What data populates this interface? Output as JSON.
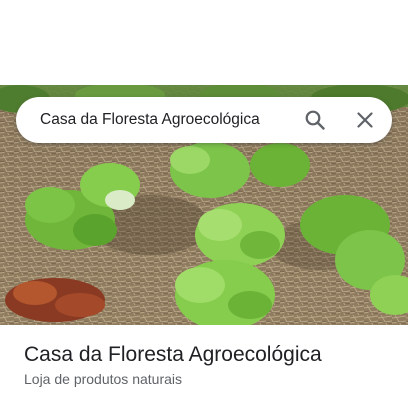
{
  "search": {
    "query": "Casa da Floresta Agroecológica",
    "search_icon": "search-icon",
    "close_icon": "close-icon"
  },
  "place": {
    "name": "Casa da Floresta Agroecológica",
    "category": "Loja de produtos naturais"
  },
  "colors": {
    "text_primary": "#202124",
    "text_secondary": "#5f6368",
    "icon": "#5f6368",
    "search_bar_bg": "#ffffff"
  }
}
